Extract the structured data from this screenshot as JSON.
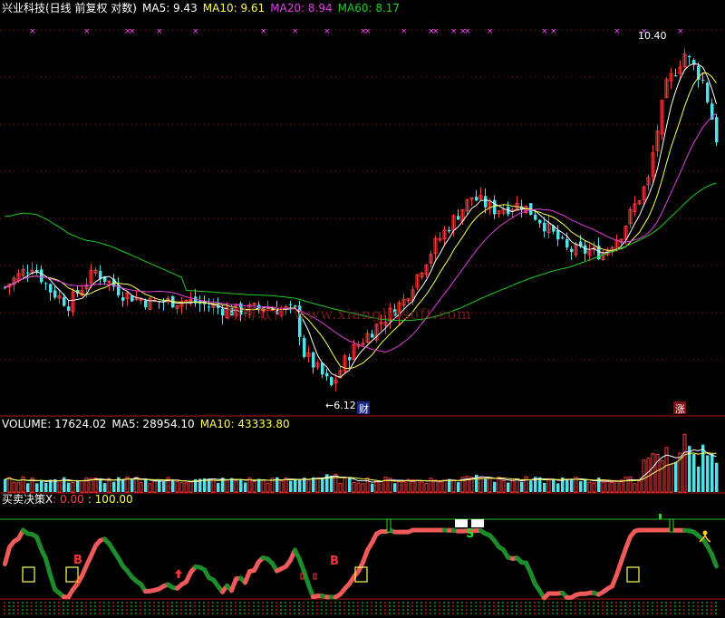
{
  "main_header": {
    "title": "兴业科技(日线 前复权 对数)",
    "ma5": "MA5: 9.43",
    "ma10": "MA10: 9.61",
    "ma20": "MA20: 8.94",
    "ma60": "MA60: 8.17"
  },
  "vol_header": {
    "title": "VOLUME: 17624.02",
    "ma5": "MA5: 28954.10",
    "ma10": "MA10: 43333.80"
  },
  "ind_header": {
    "title": "买卖决策X",
    "v1": ": 0.00",
    "v2": ": 100.00"
  },
  "watermark": "翔博软件 www.xiangbosoft.com",
  "colors": {
    "up": "#ff3b3b",
    "down": "#53e0e8",
    "ma5": "#ffffff",
    "ma10": "#ffff55",
    "ma20": "#e040e0",
    "ma60": "#22cc22",
    "signal_red": "#f05a5a",
    "signal_green": "#1e8c2a"
  },
  "chart_data": [
    {
      "type": "candlestick",
      "title": "兴业科技(日线 前复权 对数)",
      "scale": "log",
      "annotations": [
        {
          "text": "10.40",
          "kind": "high"
        },
        {
          "text": "←6.12",
          "kind": "low"
        },
        {
          "text": "财",
          "kind": "event"
        },
        {
          "text": "涨",
          "kind": "event"
        }
      ],
      "series": [
        {
          "name": "MA5",
          "value": 9.43
        },
        {
          "name": "MA10",
          "value": 9.61
        },
        {
          "name": "MA20",
          "value": 8.94
        },
        {
          "name": "MA60",
          "value": 8.17
        }
      ]
    },
    {
      "type": "bar",
      "title": "VOLUME",
      "values_last": 17624.02,
      "series": [
        {
          "name": "MA5",
          "value": 28954.1
        },
        {
          "name": "MA10",
          "value": 43333.8
        }
      ]
    },
    {
      "type": "area",
      "title": "买卖决策X",
      "levels": [
        0.0,
        100.0
      ],
      "markers": [
        "B",
        "B",
        "S"
      ]
    }
  ]
}
